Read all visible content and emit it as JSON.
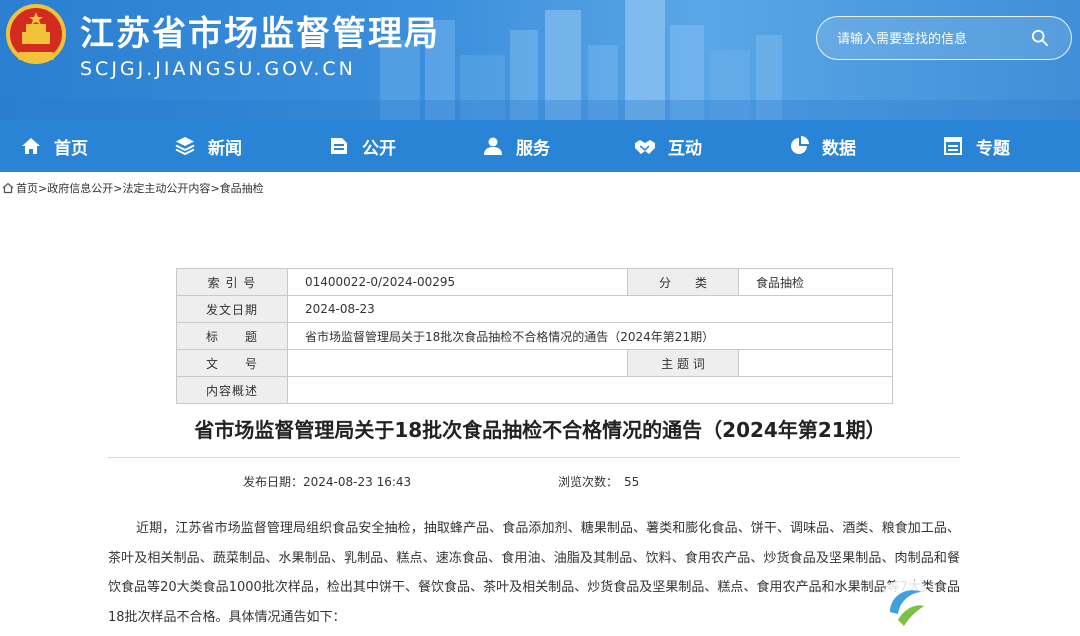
{
  "header": {
    "title": "江苏省市场监督管理局",
    "url": "SCJGJ.JIANGSU.GOV.CN",
    "search_placeholder": "请输入需要查找的信息"
  },
  "nav": {
    "items": [
      {
        "label": "首页",
        "icon": "home-icon"
      },
      {
        "label": "新闻",
        "icon": "layers-icon"
      },
      {
        "label": "公开",
        "icon": "open-icon"
      },
      {
        "label": "服务",
        "icon": "people-icon"
      },
      {
        "label": "互动",
        "icon": "handshake-icon"
      },
      {
        "label": "数据",
        "icon": "pie-chart-icon"
      },
      {
        "label": "专题",
        "icon": "calendar-icon"
      }
    ]
  },
  "breadcrumb": {
    "items": [
      "首页",
      "政府信息公开",
      "法定主动公开内容",
      "食品抽检"
    ],
    "separator": ">"
  },
  "meta": {
    "index_label": "索 引 号",
    "index_value": "01400022-0/2024-00295",
    "category_label": "分　　类",
    "category_value": "食品抽检",
    "date_label": "发文日期",
    "date_value": "2024-08-23",
    "title_label": "标　　题",
    "title_value": "省市场监督管理局关于18批次食品抽检不合格情况的通告（2024年第21期）",
    "docno_label": "文　　号",
    "docno_value": "",
    "keywords_label": "主 题 词",
    "keywords_value": "",
    "summary_label": "内容概述",
    "summary_value": ""
  },
  "article": {
    "title": "省市场监督管理局关于18批次食品抽检不合格情况的通告（2024年第21期）",
    "publish_label": "发布日期：",
    "publish_value": "2024-08-23 16:43",
    "views_label": "浏览次数：",
    "views_value": "55",
    "body": "近期，江苏省市场监督管理局组织食品安全抽检，抽取蜂产品、食品添加剂、糖果制品、薯类和膨化食品、饼干、调味品、酒类、粮食加工品、茶叶及相关制品、蔬菜制品、水果制品、乳制品、糕点、速冻食品、食用油、油脂及其制品、饮料、食用农产品、炒货食品及坚果制品、肉制品和餐饮食品等20大类食品1000批次样品，检出其中饼干、餐饮食品、茶叶及相关制品、炒货食品及坚果制品、糕点、食用农产品和水果制品等7大类食品18批次样品不合格。具体情况通告如下："
  },
  "colors": {
    "banner": "#3b8fdc",
    "nav": "#2a84d6",
    "table_label_bg": "#eeeeee"
  }
}
